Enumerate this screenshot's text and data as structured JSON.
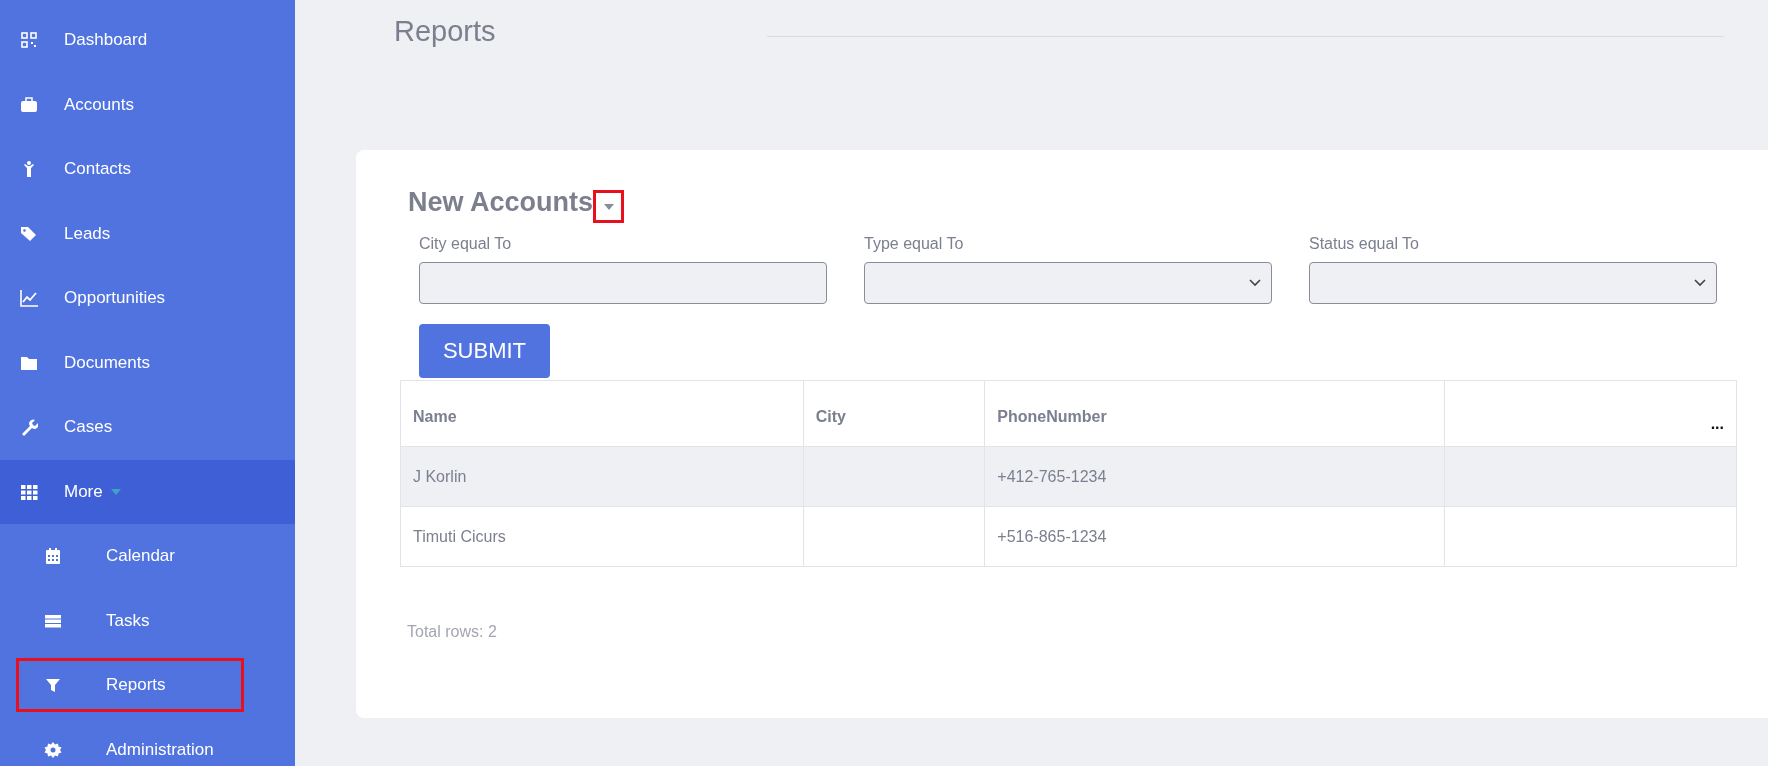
{
  "sidebar": {
    "items": [
      {
        "label": "Dashboard",
        "selected": false
      },
      {
        "label": "Accounts",
        "selected": false
      },
      {
        "label": "Contacts",
        "selected": false
      },
      {
        "label": "Leads",
        "selected": false
      },
      {
        "label": "Opportunities",
        "selected": false
      },
      {
        "label": "Documents",
        "selected": false
      },
      {
        "label": "Cases",
        "selected": false
      },
      {
        "label": "More",
        "selected": true,
        "expanded": true,
        "children": [
          {
            "label": "Calendar",
            "outlined": false
          },
          {
            "label": "Tasks",
            "outlined": false
          },
          {
            "label": "Reports",
            "outlined": true
          },
          {
            "label": "Administration",
            "outlined": false
          }
        ]
      }
    ]
  },
  "page": {
    "title": "Reports"
  },
  "report": {
    "title": "New Accounts",
    "caret_outlined": true,
    "filters": [
      {
        "label": "City equal To",
        "kind": "text"
      },
      {
        "label": "Type equal To",
        "kind": "select"
      },
      {
        "label": "Status equal To",
        "kind": "select"
      }
    ],
    "submit": "SUBMIT",
    "table": {
      "columns": [
        "Name",
        "City",
        "PhoneNumber"
      ],
      "menu": "...",
      "rows": [
        {
          "name": "J Korlin",
          "phone": "+412-765-1234"
        },
        {
          "name": "Timuti Cicurs",
          "phone": "+516-865-1234"
        }
      ]
    },
    "footer": "Total rows: 2"
  }
}
